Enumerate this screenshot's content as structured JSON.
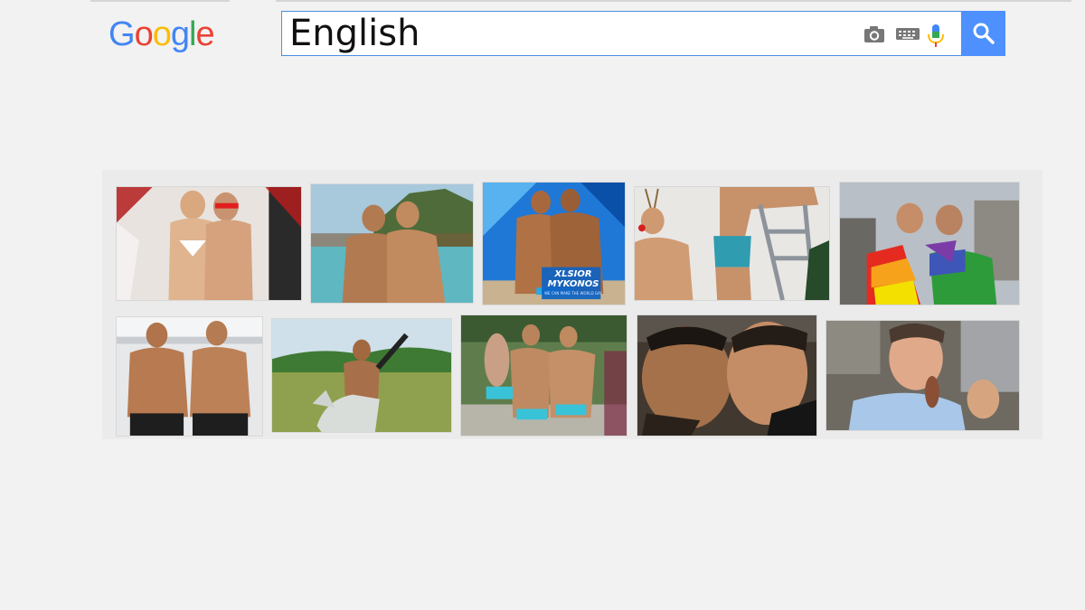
{
  "logo": {
    "letters": [
      "G",
      "o",
      "o",
      "g",
      "l",
      "e"
    ],
    "colors": [
      "#4285F4",
      "#EA4335",
      "#FBBC05",
      "#4285F4",
      "#34A853",
      "#EA4335"
    ]
  },
  "search": {
    "query": "English"
  },
  "toolbar": {
    "icons": [
      "camera-icon",
      "keyboard-icon",
      "microphone-icon",
      "search-icon"
    ],
    "accent": "#4d90fe"
  },
  "results": {
    "row_1": [
      {
        "name": "image-result-1",
        "badge": ""
      },
      {
        "name": "image-result-2",
        "badge": ""
      },
      {
        "name": "image-result-3",
        "badge": "XLSIOR MYKONOS",
        "badge_subtitle": "WE CAN MAKE THE WORLD GAY"
      },
      {
        "name": "image-result-4",
        "badge": ""
      },
      {
        "name": "image-result-5",
        "badge": ""
      }
    ],
    "row_2": [
      {
        "name": "image-result-6",
        "badge": ""
      },
      {
        "name": "image-result-7",
        "badge": ""
      },
      {
        "name": "image-result-8",
        "badge": ""
      },
      {
        "name": "image-result-9",
        "badge": ""
      },
      {
        "name": "image-result-10",
        "badge": ""
      }
    ]
  }
}
